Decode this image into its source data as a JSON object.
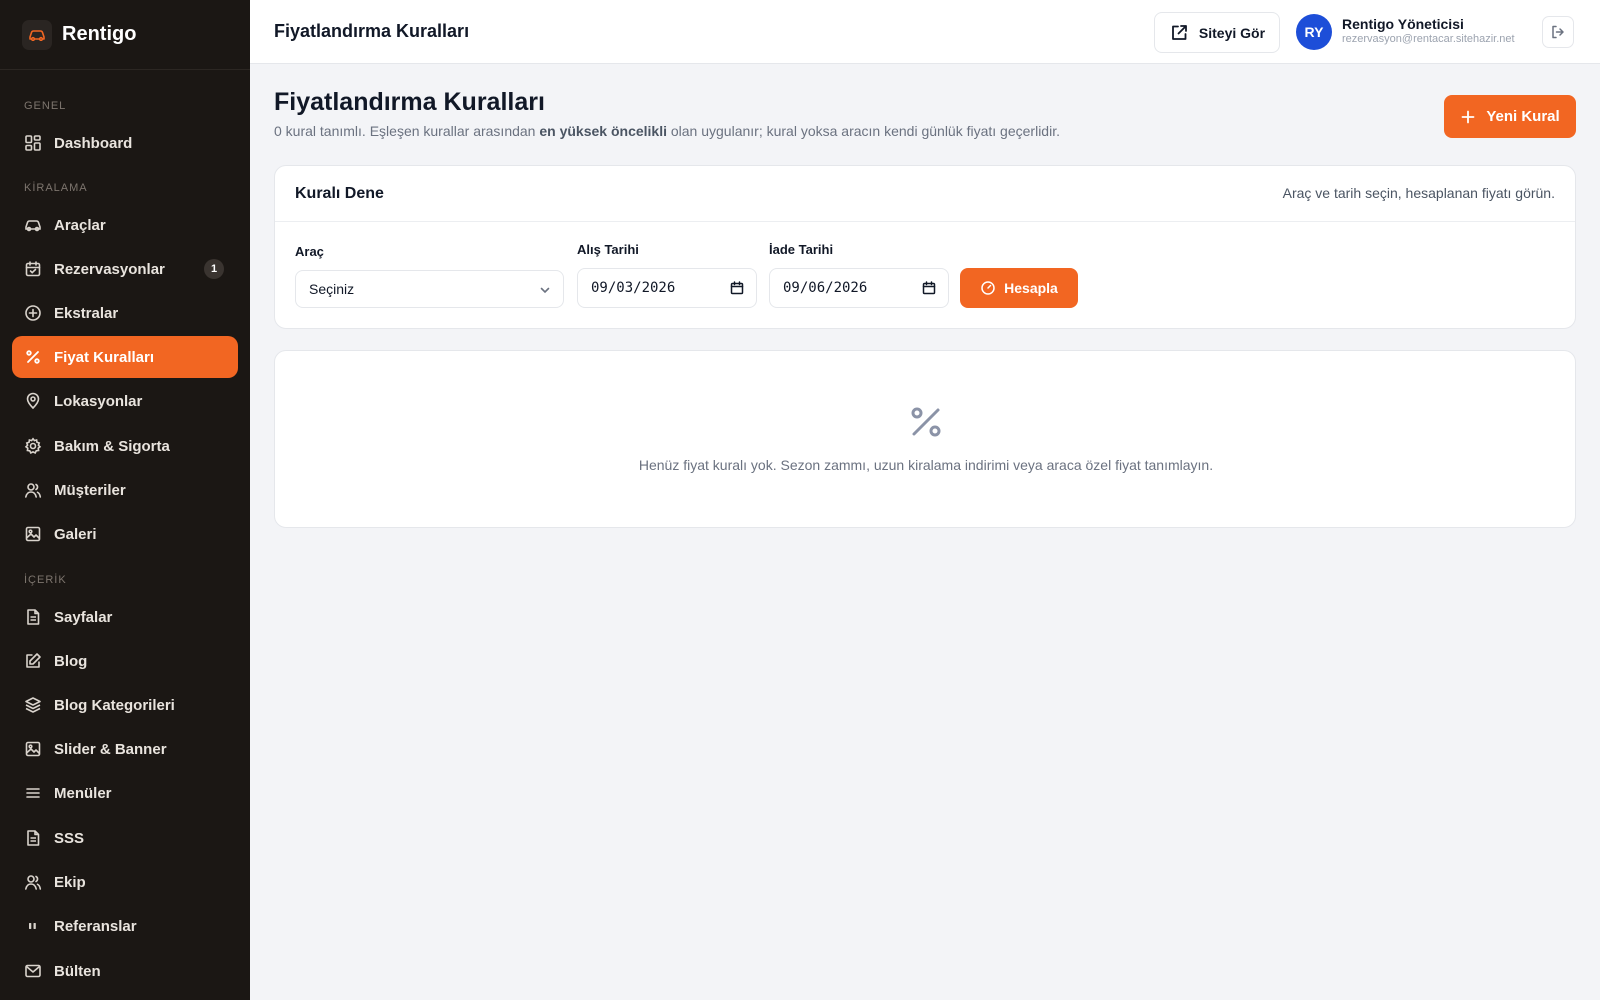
{
  "brand": {
    "name": "Rentigo",
    "logo_icon": "car-icon"
  },
  "sidebar": {
    "sections": [
      {
        "label": "GENEL"
      },
      {
        "label": "KİRALAMA"
      },
      {
        "label": "İÇERİK"
      }
    ],
    "items": [
      {
        "label": "Dashboard",
        "icon": "dashboard-icon"
      },
      {
        "label": "Araçlar",
        "icon": "car-icon"
      },
      {
        "label": "Rezervasyonlar",
        "icon": "calendar-icon",
        "badge": "1"
      },
      {
        "label": "Ekstralar",
        "icon": "plus-circle-icon"
      },
      {
        "label": "Fiyat Kuralları",
        "icon": "percent-icon",
        "active": true
      },
      {
        "label": "Lokasyonlar",
        "icon": "map-pin-icon"
      },
      {
        "label": "Bakım & Sigorta",
        "icon": "gear-icon"
      },
      {
        "label": "Müşteriler",
        "icon": "user-icon"
      },
      {
        "label": "Galeri",
        "icon": "image-icon"
      },
      {
        "label": "Sayfalar",
        "icon": "document-icon"
      },
      {
        "label": "Blog",
        "icon": "edit-icon"
      },
      {
        "label": "Blog Kategorileri",
        "icon": "layers-icon"
      },
      {
        "label": "Slider & Banner",
        "icon": "image-icon"
      },
      {
        "label": "Menüler",
        "icon": "menu-icon"
      },
      {
        "label": "SSS",
        "icon": "document-icon"
      },
      {
        "label": "Ekip",
        "icon": "users-icon"
      },
      {
        "label": "Referanslar",
        "icon": "quote-icon"
      },
      {
        "label": "Bülten",
        "icon": "mail-icon"
      }
    ]
  },
  "header": {
    "title": "Fiyatlandırma Kuralları",
    "site_button": "Siteyi Gör",
    "user": {
      "initials": "RY",
      "name": "Rentigo Yöneticisi",
      "email": "rezervasyon@rentacar.sitehazir.net"
    }
  },
  "page": {
    "title": "Fiyatlandırma Kuralları",
    "desc_prefix": "0 kural tanımlı. Eşleşen kurallar arasından ",
    "desc_bold": "en yüksek öncelikli",
    "desc_suffix": " olan uygulanır; kural yoksa aracın kendi günlük fiyatı geçerlidir.",
    "new_button": "Yeni Kural"
  },
  "test_card": {
    "title": "Kuralı Dene",
    "hint": "Araç ve tarih seçin, hesaplanan fiyatı görün.",
    "vehicle_label": "Araç",
    "vehicle_value": "Seçiniz",
    "pickup_label": "Alış Tarihi",
    "pickup_value": "09/03/2026",
    "return_label": "İade Tarihi",
    "return_value": "09/06/2026",
    "calc_button": "Hesapla"
  },
  "empty_state": {
    "icon": "percent-icon",
    "text": "Henüz fiyat kuralı yok. Sezon zammı, uzun kiralama indirimi veya araca özel fiyat tanımlayın."
  },
  "colors": {
    "accent": "#f26622",
    "sidebar_bg": "#1b1714",
    "avatar_bg": "#1d4ed8"
  }
}
